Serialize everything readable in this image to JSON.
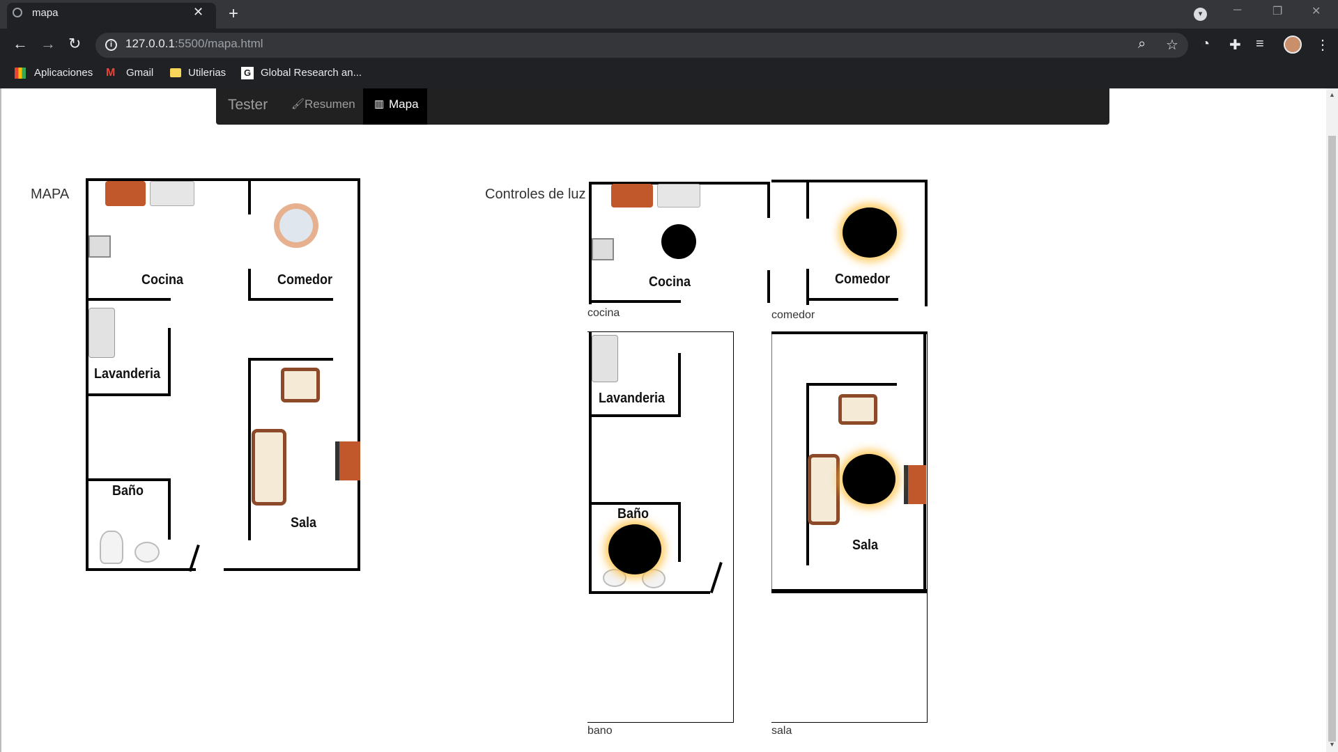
{
  "browser": {
    "tab_title": "mapa",
    "tab_close": "✕",
    "new_tab": "+",
    "url_host": "127.0.0.1",
    "url_path": ":5500/mapa.html",
    "window_min": "─",
    "window_restore": "❐",
    "window_close": "✕",
    "bookmarks": [
      "Aplicaciones",
      "Gmail",
      "Utilerias",
      "Global Research an..."
    ]
  },
  "navbar": {
    "brand": "Tester",
    "links": [
      {
        "label": "Resumen",
        "icon": "brush-icon",
        "active": false
      },
      {
        "label": "Mapa",
        "icon": "map-icon",
        "active": true
      }
    ]
  },
  "map": {
    "title": "MAPA",
    "rooms": [
      "Cocina",
      "Comedor",
      "Lavanderia",
      "Baño",
      "Sala"
    ]
  },
  "controls": {
    "title": "Controles de luz",
    "panels": [
      {
        "id": "cocina",
        "caption": "cocina",
        "room_labels": [
          "Cocina"
        ],
        "light_on": false
      },
      {
        "id": "comedor",
        "caption": "comedor",
        "room_labels": [
          "Comedor"
        ],
        "light_on": true
      },
      {
        "id": "bano",
        "caption": "bano",
        "room_labels": [
          "Lavanderia",
          "Baño"
        ],
        "light_on": true
      },
      {
        "id": "sala",
        "caption": "sala",
        "room_labels": [
          "Sala"
        ],
        "light_on": true
      }
    ]
  },
  "colors": {
    "navbar_bg": "#212121",
    "active_tab_bg": "#000000",
    "furniture_wood": "#c0582c",
    "light_glow": "#ffbe3c"
  }
}
